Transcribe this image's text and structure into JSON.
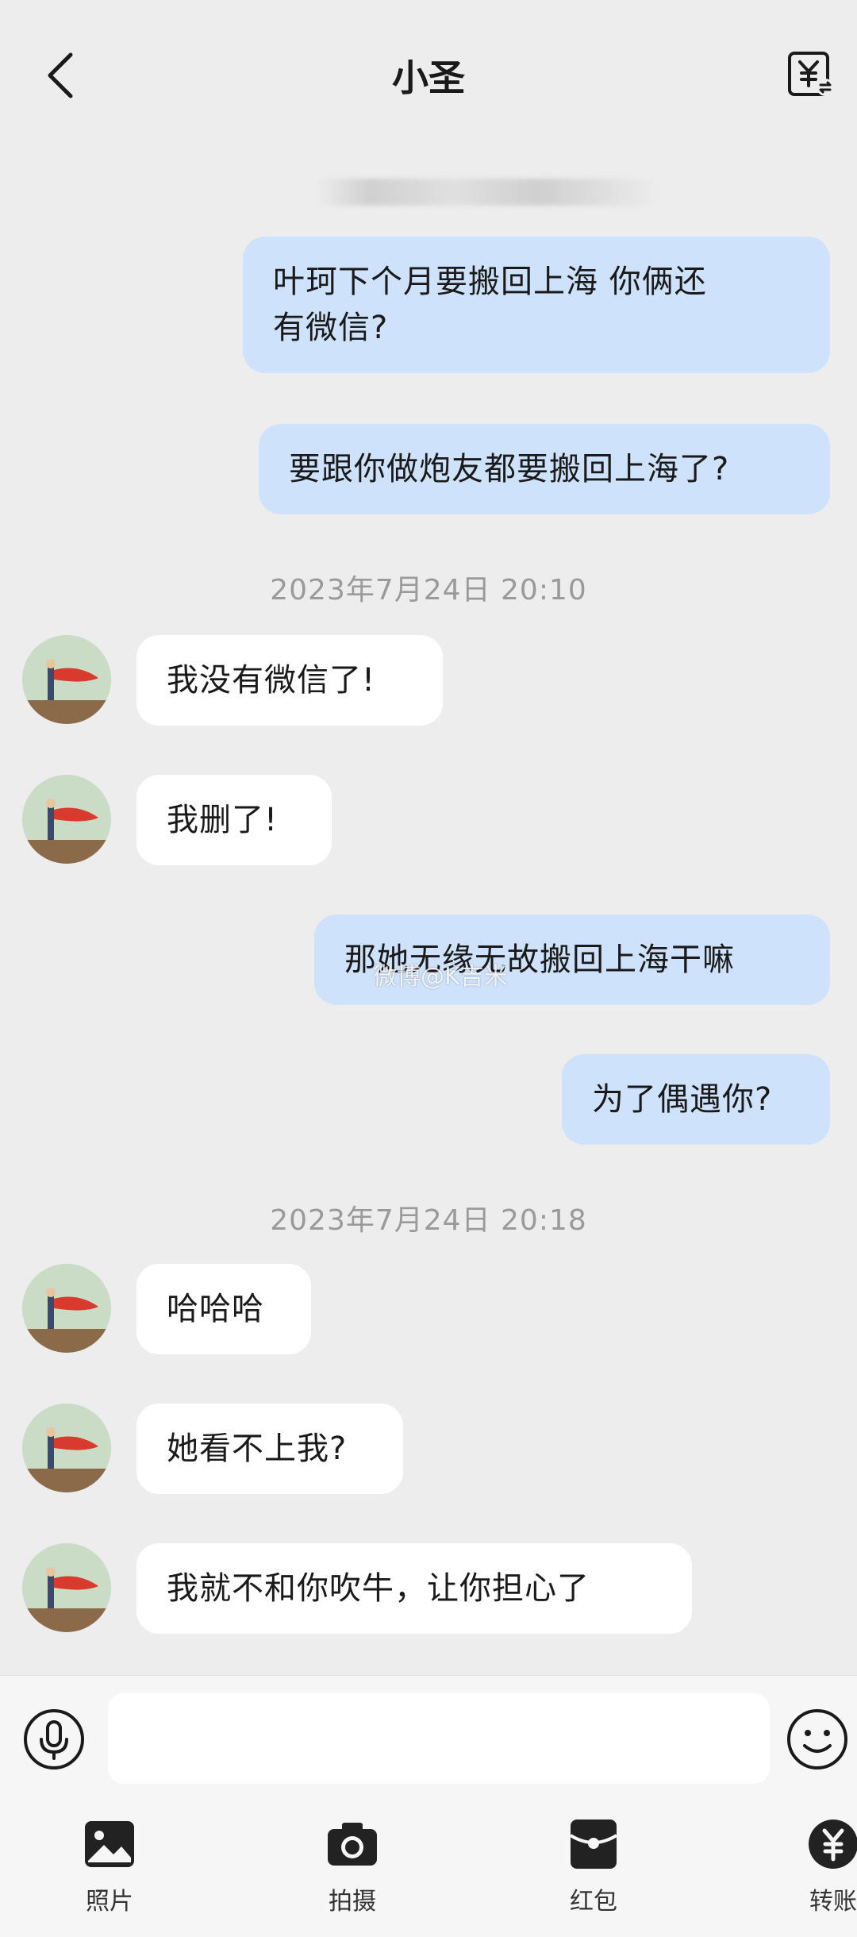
{
  "header": {
    "title": "小圣",
    "back_icon": "back-arrow-icon",
    "right_icon": "yuan-transfer-icon"
  },
  "messages": [
    {
      "side": "me",
      "text_lines": [
        "叶珂下个月要搬回上海 你俩还",
        "有微信?"
      ]
    },
    {
      "side": "me",
      "text_lines": [
        "要跟你做炮友都要搬回上海了?"
      ]
    },
    {
      "type": "time",
      "text": "2023年7月24日 20:10"
    },
    {
      "side": "them",
      "text_lines": [
        "我没有微信了!"
      ]
    },
    {
      "side": "them",
      "text_lines": [
        "我删了!"
      ]
    },
    {
      "side": "me",
      "text_lines": [
        "那她无缘无故搬回上海干嘛"
      ]
    },
    {
      "side": "me",
      "text_lines": [
        "为了偶遇你?"
      ]
    },
    {
      "type": "time",
      "text": "2023年7月24日 20:18"
    },
    {
      "side": "them",
      "text_lines": [
        "哈哈哈"
      ]
    },
    {
      "side": "them",
      "text_lines": [
        "她看不上我?"
      ]
    },
    {
      "side": "them",
      "text_lines": [
        "我就不和你吹牛，让你担心了"
      ]
    }
  ],
  "watermark": "微博@K吉米",
  "input": {
    "placeholder": "",
    "value": ""
  },
  "toolbar": {
    "items": [
      {
        "label": "照片",
        "icon": "photo-icon"
      },
      {
        "label": "拍摄",
        "icon": "camera-icon"
      },
      {
        "label": "红包",
        "icon": "red-packet-icon"
      },
      {
        "label": "转账",
        "icon": "transfer-icon"
      }
    ]
  },
  "colors": {
    "background": "#ededed",
    "my_bubble": "#cfe2fb",
    "their_bubble": "#ffffff",
    "timestamp": "#9a9a9a"
  }
}
